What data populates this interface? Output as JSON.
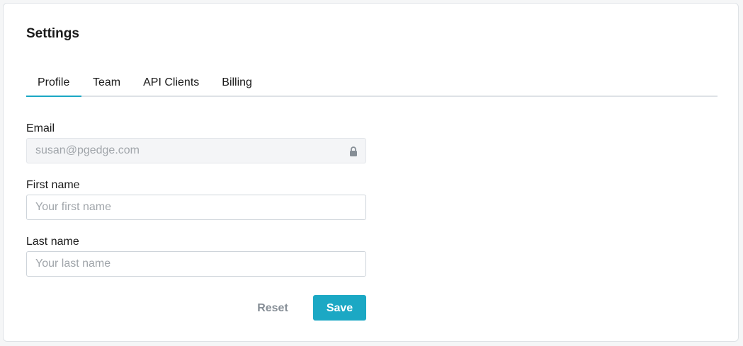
{
  "page": {
    "title": "Settings"
  },
  "tabs": [
    {
      "label": "Profile",
      "active": true
    },
    {
      "label": "Team",
      "active": false
    },
    {
      "label": "API Clients",
      "active": false
    },
    {
      "label": "Billing",
      "active": false
    }
  ],
  "form": {
    "email": {
      "label": "Email",
      "value": "susan@pgedge.com",
      "locked": true,
      "icon": "lock-icon"
    },
    "first_name": {
      "label": "First name",
      "value": "",
      "placeholder": "Your first name"
    },
    "last_name": {
      "label": "Last name",
      "value": "",
      "placeholder": "Your last name"
    }
  },
  "actions": {
    "reset_label": "Reset",
    "save_label": "Save"
  },
  "colors": {
    "accent": "#1ba8c4",
    "muted": "#868e96",
    "border": "#dee2e6"
  }
}
